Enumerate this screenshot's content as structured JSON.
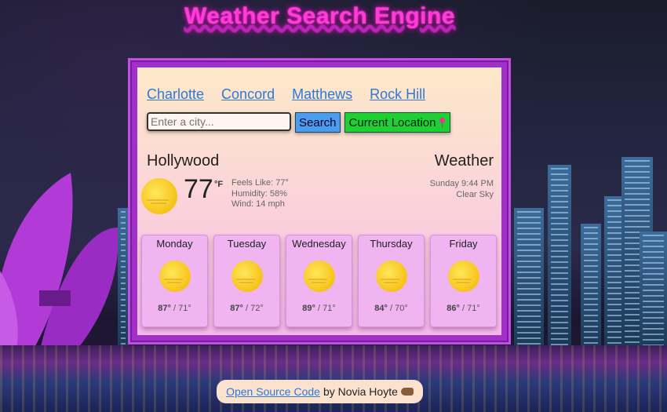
{
  "title": "Weather Search Engine",
  "cities": [
    "Charlotte",
    "Concord",
    "Matthews",
    "Rock Hill"
  ],
  "search": {
    "placeholder": "Enter a city...",
    "button": "Search",
    "location_button": "Current Location"
  },
  "current": {
    "city": "Hollywood",
    "heading": "Weather",
    "temp": "77",
    "unit": "°F",
    "feels_like": "Feels Like: 77°",
    "humidity": "Humidity: 58%",
    "wind": "Wind: 14 mph",
    "datetime": "Sunday 9:44 PM",
    "description": "Clear Sky",
    "icon": "sun-icon"
  },
  "forecast": [
    {
      "day": "Monday",
      "high": "87°",
      "low": "71°",
      "icon": "sun-icon"
    },
    {
      "day": "Tuesday",
      "high": "87°",
      "low": "72°",
      "icon": "sun-icon"
    },
    {
      "day": "Wednesday",
      "high": "89°",
      "low": "71°",
      "icon": "sun-icon"
    },
    {
      "day": "Thursday",
      "high": "84°",
      "low": "70°",
      "icon": "sun-icon"
    },
    {
      "day": "Friday",
      "high": "86°",
      "low": "71°",
      "icon": "sun-icon"
    }
  ],
  "footer": {
    "link": "Open Source Code",
    "text": "by Novia Hoyte"
  },
  "colors": {
    "title": "#ff3dd5",
    "card_border": "#a030c8",
    "search_button": "#4a9cf0",
    "location_button": "#1fd034",
    "link": "#2f78d6"
  }
}
